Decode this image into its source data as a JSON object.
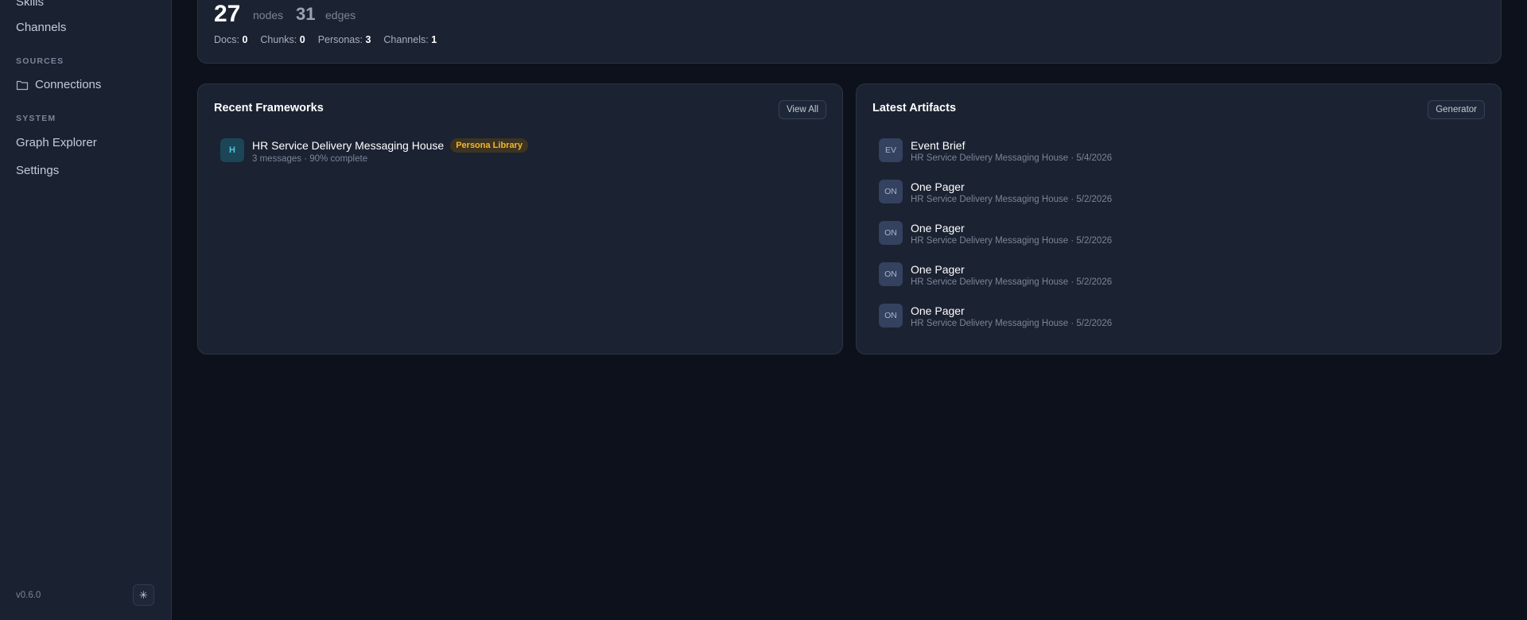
{
  "sidebar": {
    "items": [
      {
        "label": "Skills"
      },
      {
        "label": "Channels"
      },
      {
        "label": "Connections"
      },
      {
        "label": "Graph Explorer"
      },
      {
        "label": "Settings"
      }
    ],
    "sections": {
      "sources": "SOURCES",
      "system": "SYSTEM"
    },
    "version": "v0.6.0",
    "theme_icon": "sun-icon"
  },
  "stats": {
    "nodes_value": "27",
    "nodes_label": "nodes",
    "edges_value": "31",
    "edges_label": "edges",
    "docs_label": "Docs:",
    "docs_value": "0",
    "chunks_label": "Chunks:",
    "chunks_value": "0",
    "personas_label": "Personas:",
    "personas_value": "3",
    "channels_label": "Channels:",
    "channels_value": "1"
  },
  "frameworks": {
    "title": "Recent Frameworks",
    "button": "View All",
    "items": [
      {
        "avatar": "H",
        "title": "HR Service Delivery Messaging House",
        "badge": "Persona Library",
        "subtitle": "3 messages · 90% complete"
      }
    ]
  },
  "artifacts": {
    "title": "Latest Artifacts",
    "button": "Generator",
    "items": [
      {
        "avatar": "EV",
        "title": "Event Brief",
        "subtitle": "HR Service Delivery Messaging House · 5/4/2026"
      },
      {
        "avatar": "ON",
        "title": "One Pager",
        "subtitle": "HR Service Delivery Messaging House · 5/2/2026"
      },
      {
        "avatar": "ON",
        "title": "One Pager",
        "subtitle": "HR Service Delivery Messaging House · 5/2/2026"
      },
      {
        "avatar": "ON",
        "title": "One Pager",
        "subtitle": "HR Service Delivery Messaging House · 5/2/2026"
      },
      {
        "avatar": "ON",
        "title": "One Pager",
        "subtitle": "HR Service Delivery Messaging House · 5/2/2026"
      }
    ]
  },
  "colors": {
    "background": "#0c111b",
    "sidebar": "#1a2232",
    "card": "#1b2232",
    "badge_text": "#f2b632",
    "framework_avatar": "#4fc3e0"
  }
}
